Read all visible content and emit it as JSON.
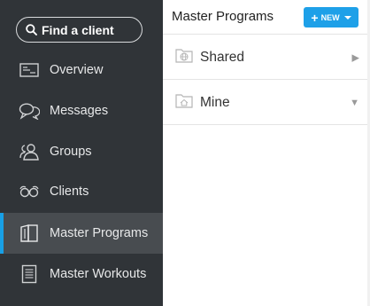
{
  "sidebar": {
    "search": {
      "placeholder": "Find a client"
    },
    "items": [
      {
        "label": "Overview",
        "icon": "overview-icon"
      },
      {
        "label": "Messages",
        "icon": "messages-icon"
      },
      {
        "label": "Groups",
        "icon": "groups-icon"
      },
      {
        "label": "Clients",
        "icon": "clients-icon"
      },
      {
        "label": "Master Programs",
        "icon": "book-icon",
        "active": true
      },
      {
        "label": "Master Workouts",
        "icon": "document-icon"
      }
    ]
  },
  "main": {
    "title": "Master Programs",
    "new_button": {
      "label": "NEW"
    },
    "folders": [
      {
        "label": "Shared",
        "icon": "globe-folder-icon",
        "state": "collapsed"
      },
      {
        "label": "Mine",
        "icon": "home-folder-icon",
        "state": "expanded"
      }
    ]
  },
  "colors": {
    "sidebar_bg": "#303438",
    "active_bg": "#484c50",
    "accent": "#18a0e6",
    "button": "#1ea0e8"
  }
}
